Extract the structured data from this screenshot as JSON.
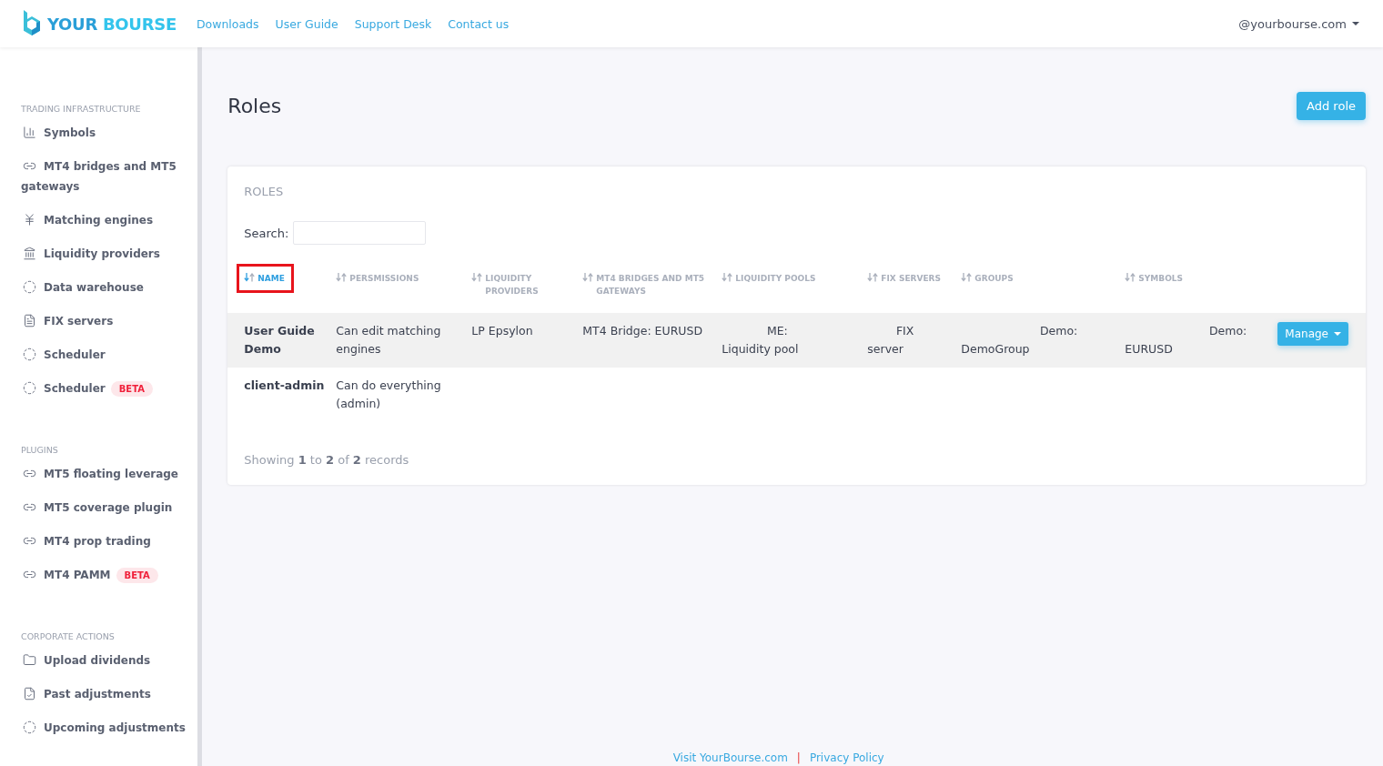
{
  "header": {
    "logo": {
      "word1": "YOUR",
      "word2": "BOURSE"
    },
    "nav": [
      "Downloads",
      "User Guide",
      "Support Desk",
      "Contact us"
    ],
    "account": "@yourbourse.com"
  },
  "sidebar": {
    "sections": [
      {
        "title": "TRADING INFRASTRUCTURE",
        "items": [
          {
            "label": "Symbols"
          },
          {
            "label": "MT4 bridges and MT5 gateways"
          },
          {
            "label": "Matching engines"
          },
          {
            "label": "Liquidity providers"
          },
          {
            "label": "Data warehouse"
          },
          {
            "label": "FIX servers"
          },
          {
            "label": "Scheduler"
          },
          {
            "label": "Scheduler",
            "badge": "BETA"
          }
        ]
      },
      {
        "title": "PLUGINS",
        "items": [
          {
            "label": "MT5 floating leverage"
          },
          {
            "label": "MT5 coverage plugin"
          },
          {
            "label": "MT4 prop trading"
          },
          {
            "label": "MT4 PAMM",
            "badge": "BETA"
          }
        ]
      },
      {
        "title": "CORPORATE ACTIONS",
        "items": [
          {
            "label": "Upload dividends"
          },
          {
            "label": "Past adjustments"
          },
          {
            "label": "Upcoming adjustments"
          }
        ]
      }
    ]
  },
  "page": {
    "title": "Roles",
    "add_button": "Add role"
  },
  "card": {
    "title": "ROLES",
    "search": {
      "label": "Search:"
    },
    "table": {
      "columns": [
        {
          "label": "NAME",
          "sorted": true,
          "highlighted": true
        },
        {
          "label": "PERSMISSIONS",
          "sorted": false,
          "highlighted": false
        },
        {
          "label": "LIQUIDITY PROVIDERS",
          "sorted": false,
          "highlighted": false
        },
        {
          "label": "MT4 BRIDGES AND MT5 GATEWAYS",
          "sorted": false,
          "highlighted": false
        },
        {
          "label": "LIQUIDITY POOLS",
          "sorted": false,
          "highlighted": false
        },
        {
          "label": "FIX SERVERS",
          "sorted": false,
          "highlighted": false
        },
        {
          "label": "GROUPS",
          "sorted": false,
          "highlighted": false
        },
        {
          "label": "SYMBOLS",
          "sorted": false,
          "highlighted": false
        }
      ],
      "rows": [
        {
          "cells": [
            [
              "User Guide Demo"
            ],
            [
              "Can edit matching engines"
            ],
            [
              "LP Epsylon"
            ],
            [
              "MT4 Bridge: EURUSD"
            ],
            [
              "ME:",
              "Liquidity pool"
            ],
            [
              "FIX",
              "server"
            ],
            [
              "Demo:",
              "DemoGroup"
            ],
            [
              "Demo:",
              "EURUSD"
            ]
          ],
          "action": "Manage"
        },
        {
          "cells": [
            [
              "client-admin"
            ],
            [
              "Can do everything (admin)"
            ],
            [],
            [],
            [],
            [],
            [],
            []
          ]
        }
      ]
    },
    "info": "Showing **1** to **2** of **2** records"
  },
  "footer": {
    "links": [
      "Visit YourBourse.com",
      "Privacy Policy"
    ],
    "separator": "|"
  }
}
